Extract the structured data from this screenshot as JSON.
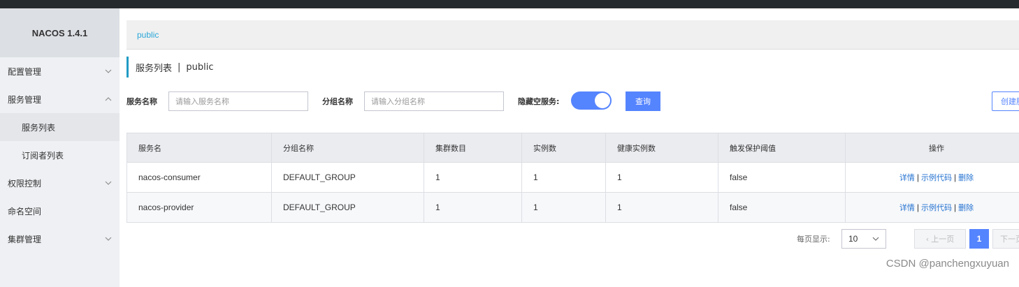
{
  "app": {
    "brand": "NACOS 1.4.1"
  },
  "sidebar": {
    "items": [
      {
        "label": "配置管理",
        "expanded": false
      },
      {
        "label": "服务管理",
        "expanded": true
      },
      {
        "label": "服务列表",
        "sub": true,
        "active": true
      },
      {
        "label": "订阅者列表",
        "sub": true
      },
      {
        "label": "权限控制",
        "expanded": false
      },
      {
        "label": "命名空间"
      },
      {
        "label": "集群管理",
        "expanded": false
      }
    ]
  },
  "namespace_bar": {
    "current": "public"
  },
  "page": {
    "title": "服务列表",
    "separator": "|",
    "namespace": "public"
  },
  "filters": {
    "service_name_label": "服务名称",
    "service_name_placeholder": "请输入服务名称",
    "group_name_label": "分组名称",
    "group_name_placeholder": "请输入分组名称",
    "hide_empty_label": "隐藏空服务:",
    "hide_empty_on": true,
    "query_label": "查询",
    "create_label": "创建服务"
  },
  "table": {
    "headers": [
      "服务名",
      "分组名称",
      "集群数目",
      "实例数",
      "健康实例数",
      "触发保护阈值",
      "操作"
    ],
    "rows": [
      {
        "service": "nacos-consumer",
        "group": "DEFAULT_GROUP",
        "clusters": "1",
        "instances": "1",
        "healthy": "1",
        "protect": "false"
      },
      {
        "service": "nacos-provider",
        "group": "DEFAULT_GROUP",
        "clusters": "1",
        "instances": "1",
        "healthy": "1",
        "protect": "false"
      }
    ],
    "actions": {
      "detail": "详情",
      "sample": "示例代码",
      "delete": "删除",
      "sep": "|"
    }
  },
  "pagination": {
    "page_size_label": "每页显示:",
    "page_size": "10",
    "prev_label": "上一页",
    "current_page": "1",
    "next_label": "下一页"
  },
  "watermark": "CSDN @panchengxuyuan",
  "colors": {
    "primary": "#5584ff",
    "accent_bar": "#209bc4",
    "link": "#2573d1",
    "topbar": "#252a2f"
  }
}
